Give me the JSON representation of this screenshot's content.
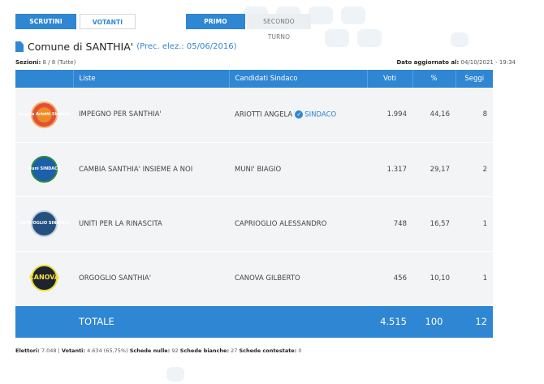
{
  "nav": {
    "scrutini": "SCRUTINI",
    "votanti": "VOTANTI",
    "primo_turno": "PRIMO TURNO",
    "secondo_turno": "SECONDO TURNO"
  },
  "header": {
    "title": "Comune di SANTHIA'",
    "prec": "(Prec. elez.: 05/06/2016)"
  },
  "subinfo": {
    "sezioni_label": "Sezioni:",
    "sezioni_value": "8 / 8 (Tutte)",
    "aggiornato_label": "Dato aggiornato al:",
    "aggiornato_value": "04/10/2021 - 19:34"
  },
  "table": {
    "headers": {
      "liste": "Liste",
      "candidati": "Candidati Sindaco",
      "voti": "Voti",
      "perc": "%",
      "seggi": "Seggi"
    },
    "rows": [
      {
        "lista": "IMPEGNO PER SANTHIA'",
        "candidato": "ARIOTTI ANGELA",
        "badge": "SINDACO",
        "voti": "1.994",
        "perc": "44,16",
        "seggi": "8",
        "logo_text": "Angela Ariotti Sindaco"
      },
      {
        "lista": "CAMBIA SANTHIA' INSIEME A NOI",
        "candidato": "MUNI' BIAGIO",
        "voti": "1.317",
        "perc": "29,17",
        "seggi": "2",
        "logo_text": "Muni SINDACO"
      },
      {
        "lista": "UNITI PER LA RINASCITA",
        "candidato": "CAPRIOGLIO ALESSANDRO",
        "voti": "748",
        "perc": "16,57",
        "seggi": "1",
        "logo_text": "CAPRIOGLIO SINDACO"
      },
      {
        "lista": "ORGOGLIO SANTHIA'",
        "candidato": "CANOVA GILBERTO",
        "voti": "456",
        "perc": "10,10",
        "seggi": "1",
        "logo_text": "CANOVA"
      }
    ],
    "totale": {
      "label": "TOTALE",
      "voti": "4.515",
      "perc": "100",
      "seggi": "12"
    }
  },
  "footer": {
    "elettori_label": "Elettori:",
    "elettori_value": "7.048",
    "votanti_label": "Votanti:",
    "votanti_value": "4.634 (65,75%)",
    "nulle_label": "Schede nulle:",
    "nulle_value": "92",
    "bianche_label": "Schede bianche:",
    "bianche_value": "27",
    "contestate_label": "Schede contestate:",
    "contestate_value": "0"
  }
}
